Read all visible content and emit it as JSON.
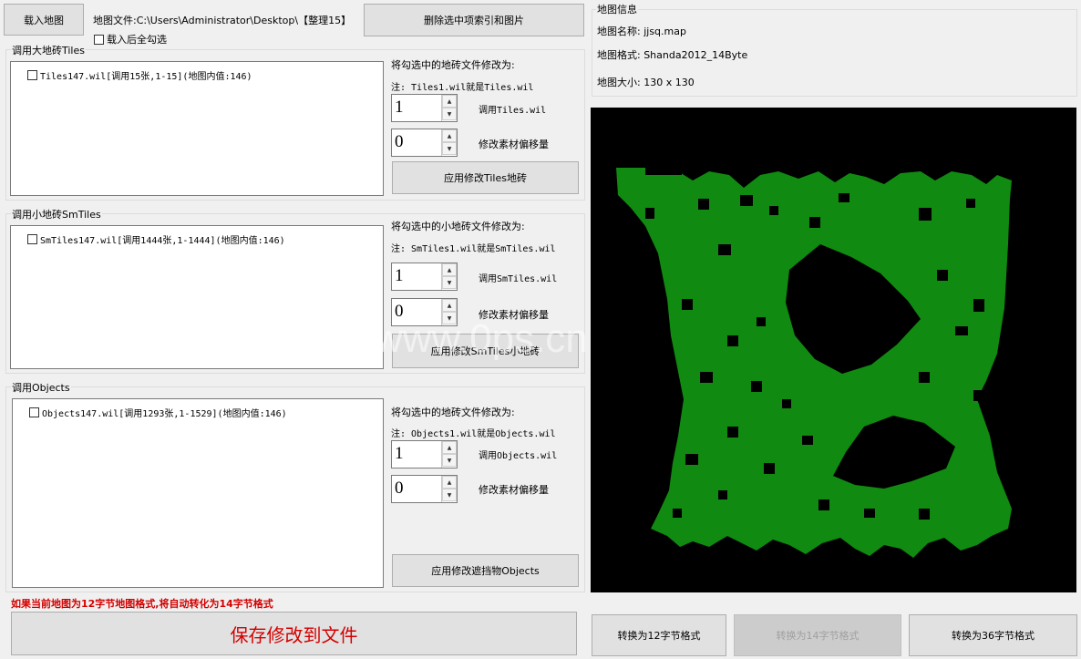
{
  "top": {
    "load_map_button": "载入地图",
    "map_file_label": "地图文件:C:\\Users\\Administrator\\Desktop\\【整理15】",
    "delete_button": "删除选中项索引和图片",
    "check_all_label": "载入后全勾选"
  },
  "tiles": {
    "group_title": "调用大地砖Tiles",
    "item": "Tiles147.wil[调用15张,1-15](地图内值:146)",
    "modify_label": "将勾选中的地砖文件修改为:",
    "note": "注: Tiles1.wil就是Tiles.wil",
    "spin1_value": "1",
    "spin1_label": "调用Tiles.wil",
    "spin2_value": "0",
    "spin2_label": "修改素材偏移量",
    "apply_button": "应用修改Tiles地砖"
  },
  "smtiles": {
    "group_title": "调用小地砖SmTiles",
    "item": "SmTiles147.wil[调用1444张,1-1444](地图内值:146)",
    "modify_label": "将勾选中的小地砖文件修改为:",
    "note": "注: SmTiles1.wil就是SmTiles.wil",
    "spin1_value": "1",
    "spin1_label": "调用SmTiles.wil",
    "spin2_value": "0",
    "spin2_label": "修改素材偏移量",
    "apply_button": "应用修改SmTiles小地砖"
  },
  "objects": {
    "group_title": "调用Objects",
    "item": "Objects147.wil[调用1293张,1-1529](地图内值:146)",
    "modify_label": "将勾选中的地砖文件修改为:",
    "note": "注: Objects1.wil就是Objects.wil",
    "spin1_value": "1",
    "spin1_label": "调用Objects.wil",
    "spin2_value": "0",
    "spin2_label": "修改素材偏移量",
    "apply_button": "应用修改遮挡物Objects"
  },
  "warning": "如果当前地图为12字节地图格式,将自动转化为14字节格式",
  "save_button": "保存修改到文件",
  "map_info": {
    "title": "地图信息",
    "name": "地图名称: jjsq.map",
    "format": "地图格式: Shanda2012_14Byte",
    "size": "地图大小: 130 x 130"
  },
  "watermark": "www.0ps.cn",
  "convert": {
    "to12": "转换为12字节格式",
    "to14": "转换为14字节格式",
    "to36": "转换为36字节格式"
  },
  "colors": {
    "map_bg": "#000000",
    "map_walkable": "#108a10",
    "warning_red": "#d40000"
  }
}
